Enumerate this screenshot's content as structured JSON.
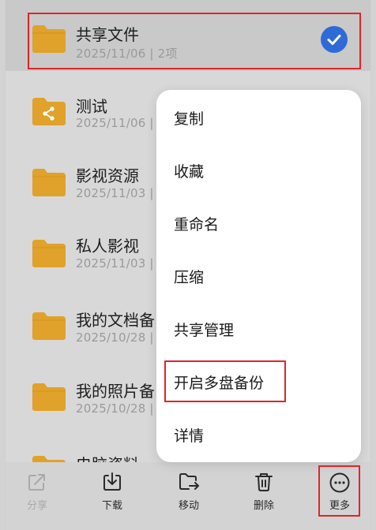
{
  "files": [
    {
      "name": "共享文件",
      "meta": "2025/11/06 | 2项",
      "selected": true,
      "shared": false
    },
    {
      "name": "测试",
      "meta": "2025/11/06 | 0",
      "selected": false,
      "shared": true
    },
    {
      "name": "影视资源",
      "meta": "2025/11/03 | 2",
      "selected": false,
      "shared": false
    },
    {
      "name": "私人影视",
      "meta": "2025/11/03 | 8",
      "selected": false,
      "shared": false
    },
    {
      "name": "我的文档备",
      "meta": "2025/10/28 | 2",
      "selected": false,
      "shared": false
    },
    {
      "name": "我的照片备",
      "meta": "2025/10/28 | 3",
      "selected": false,
      "shared": false
    },
    {
      "name": "电脑资料",
      "meta": "",
      "selected": false,
      "shared": false
    }
  ],
  "context_menu": {
    "items": [
      "复制",
      "收藏",
      "重命名",
      "压缩",
      "共享管理",
      "开启多盘备份",
      "详情"
    ]
  },
  "toolbar": {
    "share": "分享",
    "download": "下载",
    "move": "移动",
    "delete": "删除",
    "more": "更多"
  },
  "colors": {
    "folder": "#e0a22a",
    "check": "#2f6ad9",
    "highlight": "#e0242a",
    "selected_row": "#c9c9c9",
    "background": "#d8d8d8"
  },
  "icons": {
    "folder": "folder-icon",
    "shared_folder": "shared-folder-icon",
    "check": "check-icon",
    "share": "share-icon",
    "download": "download-icon",
    "move": "move-icon",
    "delete": "trash-icon",
    "more": "more-icon"
  }
}
